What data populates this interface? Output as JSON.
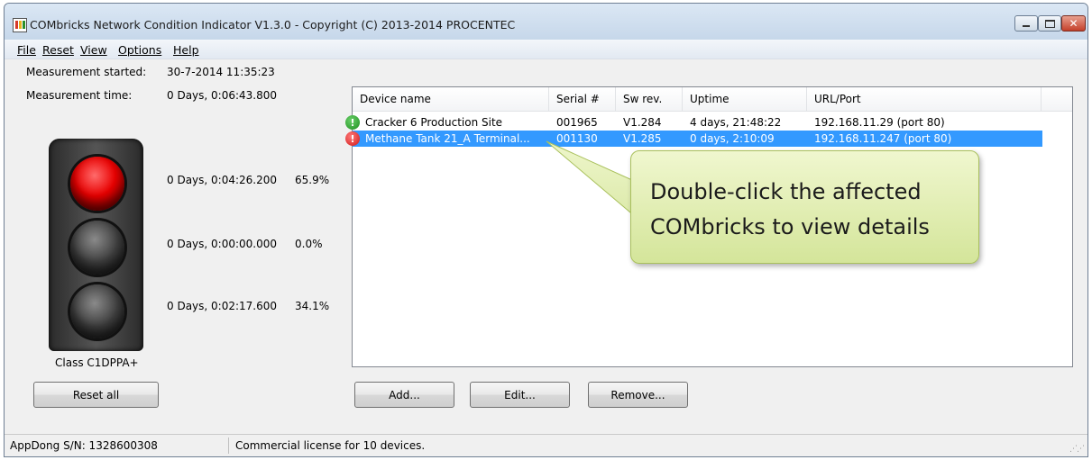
{
  "window": {
    "title": "COMbricks Network Condition Indicator V1.3.0 - Copyright (C) 2013-2014 PROCENTEC",
    "icon": "traffic-light-app-icon"
  },
  "menu": [
    "File",
    "Reset",
    "View",
    "Options",
    "Help"
  ],
  "measurement": {
    "started_label": "Measurement started:",
    "started_value": "30-7-2014 11:35:23",
    "time_label": "Measurement time:",
    "time_value": "0 Days, 0:06:43.800"
  },
  "lights": [
    {
      "state": "red-on",
      "duration": "0 Days, 0:04:26.200",
      "percent": "65.9%"
    },
    {
      "state": "off",
      "duration": "0 Days, 0:00:00.000",
      "percent": "0.0%"
    },
    {
      "state": "off",
      "duration": "0 Days, 0:02:17.600",
      "percent": "34.1%"
    }
  ],
  "class_label": "Class C1DPPA+",
  "reset_all_label": "Reset all",
  "devices": {
    "columns": [
      "Device name",
      "Serial #",
      "Sw rev.",
      "Uptime",
      "URL/Port"
    ],
    "rows": [
      {
        "status": "ok",
        "status_glyph": "!",
        "name": "Cracker 6 Production Site",
        "serial": "001965",
        "sw": "V1.284",
        "uptime": "4 days, 21:48:22",
        "url": "192.168.11.29 (port 80)",
        "selected": false
      },
      {
        "status": "error",
        "status_glyph": "!",
        "name": "Methane Tank 21_A Terminal...",
        "serial": "001130",
        "sw": "V1.285",
        "uptime": "0 days, 2:10:09",
        "url": "192.168.11.247 (port 80)",
        "selected": true
      }
    ]
  },
  "buttons": {
    "add": "Add...",
    "edit": "Edit...",
    "remove": "Remove..."
  },
  "callout": {
    "line1": "Double-click the affected",
    "line2": "COMbricks to view details"
  },
  "statusbar": {
    "serial": "AppDong S/N: 1328600308",
    "license": "Commercial license for 10 devices."
  },
  "colors": {
    "selection": "#3399ff",
    "ok": "#1e8e1e",
    "error": "#d01818",
    "callout": "#e2eeb4"
  }
}
